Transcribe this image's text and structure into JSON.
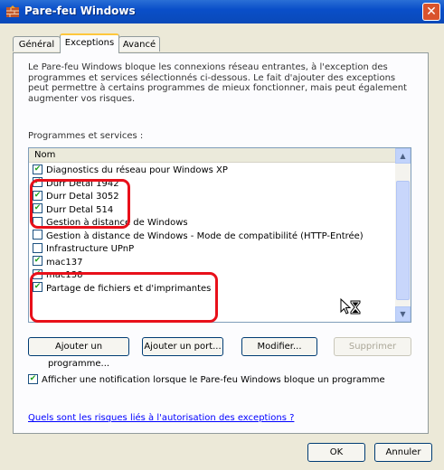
{
  "window": {
    "title": "Pare-feu Windows"
  },
  "tabs": [
    {
      "label": "Général"
    },
    {
      "label": "Exceptions"
    },
    {
      "label": "Avancé"
    }
  ],
  "intro_text": "Le Pare-feu Windows bloque les connexions réseau entrantes, à l'exception des programmes et services sélectionnés ci-dessous. Le fait d'ajouter des exceptions peut permettre à certains programmes de mieux fonctionner, mais peut également augmenter vos risques.",
  "list": {
    "label": "Programmes et services :",
    "column_header": "Nom",
    "items": [
      {
        "label": "Diagnostics du réseau pour Windows XP",
        "checked": true
      },
      {
        "label": "Durr Detal 1942",
        "checked": true
      },
      {
        "label": "Durr Detal 3052",
        "checked": true
      },
      {
        "label": "Durr Detal 514",
        "checked": true
      },
      {
        "label": "Gestion à distance de Windows",
        "checked": false
      },
      {
        "label": "Gestion à distance de Windows - Mode de compatibilité (HTTP-Entrée)",
        "checked": false
      },
      {
        "label": "Infrastructure UPnP",
        "checked": false
      },
      {
        "label": "mac137",
        "checked": true
      },
      {
        "label": "mac138",
        "checked": true
      },
      {
        "label": "Partage de fichiers et d'imprimantes",
        "checked": true
      }
    ]
  },
  "buttons": {
    "add_program": "Ajouter un programme...",
    "add_port": "Ajouter un port...",
    "modify": "Modifier...",
    "delete": "Supprimer"
  },
  "notify_checkbox": {
    "label": "Afficher une notification lorsque le Pare-feu Windows bloque un programme",
    "checked": true
  },
  "risk_link": "Quels sont les risques liés à l'autorisation des exceptions ?",
  "footer": {
    "ok": "OK",
    "cancel": "Annuler"
  },
  "colors": {
    "highlight": "#e8101a",
    "titlebar": "#0a4fc9",
    "check": "#21a121"
  },
  "icons": {
    "title": "firewall-brick-icon",
    "close": "close-x-icon",
    "cursor": "busy-cursor-icon"
  }
}
